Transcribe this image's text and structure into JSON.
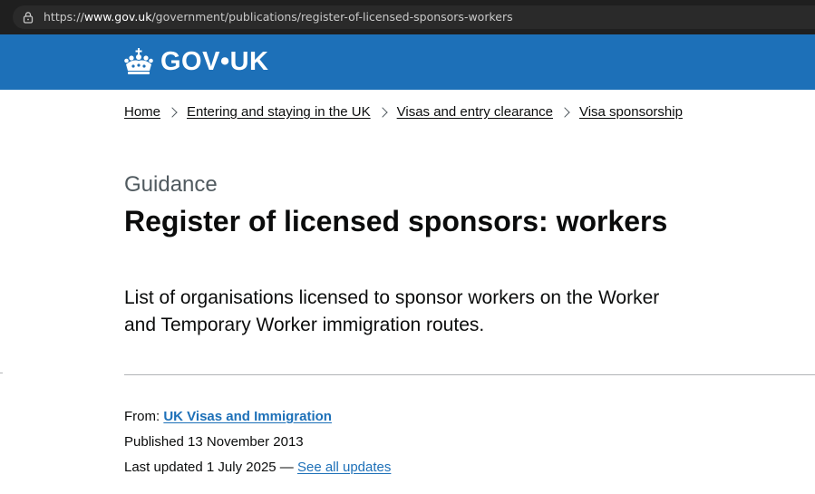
{
  "browser": {
    "url_prefix": "https://",
    "url_host": "www.gov.uk",
    "url_path": "/government/publications/register-of-licensed-sponsors-workers"
  },
  "header": {
    "logo_text": "GOV•UK",
    "logo_icon": "crown-icon",
    "background_color": "#1d70b8"
  },
  "breadcrumbs": [
    {
      "label": "Home"
    },
    {
      "label": "Entering and staying in the UK"
    },
    {
      "label": "Visas and entry clearance"
    },
    {
      "label": "Visa sponsorship"
    }
  ],
  "page": {
    "caption": "Guidance",
    "title": "Register of licensed sponsors: workers",
    "lead": "List of organisations licensed to sponsor workers on the Worker and Temporary Worker immigration routes."
  },
  "metadata": {
    "from_label": "From:",
    "from_link": "UK Visas and Immigration",
    "published_text": "Published 13 November 2013",
    "updated_text": "Last updated 1 July 2025 —",
    "see_all_updates": "See all updates",
    "link_color": "#1d70b8"
  }
}
